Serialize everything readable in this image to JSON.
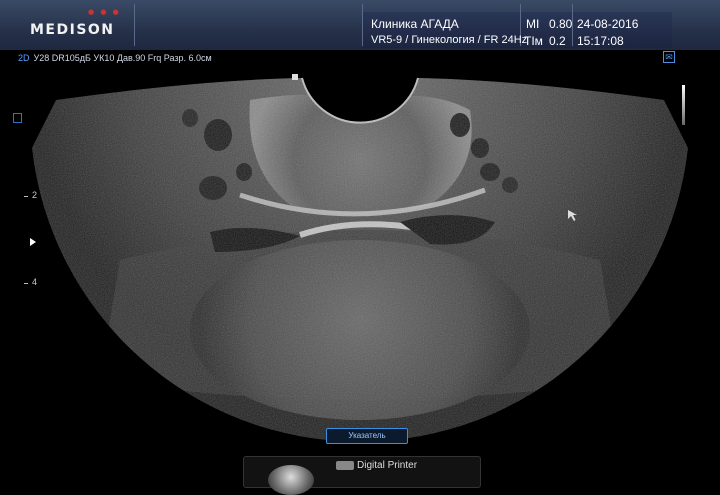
{
  "header": {
    "brand": "MEDISON",
    "clinic": "Клиника АГАДА",
    "probe_preset": "VR5-9 / Гинекология / FR 24Hz",
    "mi_label": "MI",
    "mi_value": "0.80",
    "tim_label": "TIм",
    "tim_value": "0.2",
    "date": "24-08-2016",
    "time": "15:17:08"
  },
  "scan": {
    "mode_tag": "2D",
    "params": "У28 DR105дБ УК10 Дав.90 Frq Разр. 6.0см",
    "depth_marks": [
      "2",
      "4"
    ]
  },
  "controls": {
    "pointer_button": "Указатель",
    "printer_label": "Digital Printer"
  },
  "colors": {
    "header_bg": "#26324a",
    "accent_blue": "#3b8fe0"
  }
}
